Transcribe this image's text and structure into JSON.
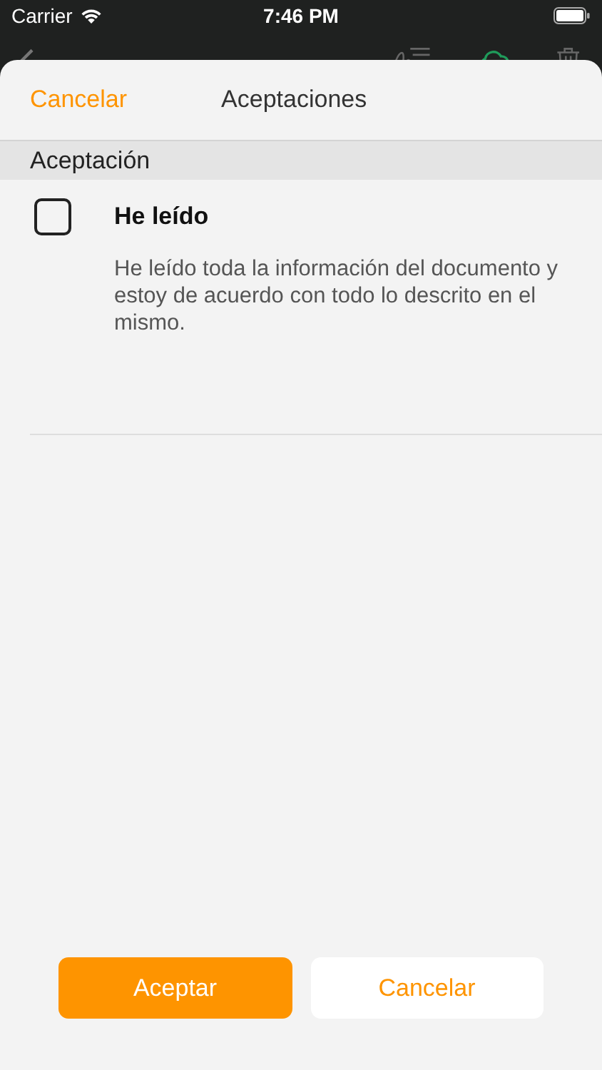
{
  "status_bar": {
    "carrier": "Carrier",
    "time": "7:46 PM"
  },
  "sheet": {
    "cancel": "Cancelar",
    "title": "Aceptaciones"
  },
  "section": {
    "title": "Aceptación"
  },
  "items": [
    {
      "title": "He leído",
      "description": "He leído toda la información del documento y estoy de acuerdo con todo lo descrito en el mismo.",
      "checked": false
    }
  ],
  "buttons": [
    {
      "kind": "primary",
      "label": "Aceptar"
    },
    {
      "kind": "secondary",
      "label": "Cancelar"
    }
  ]
}
